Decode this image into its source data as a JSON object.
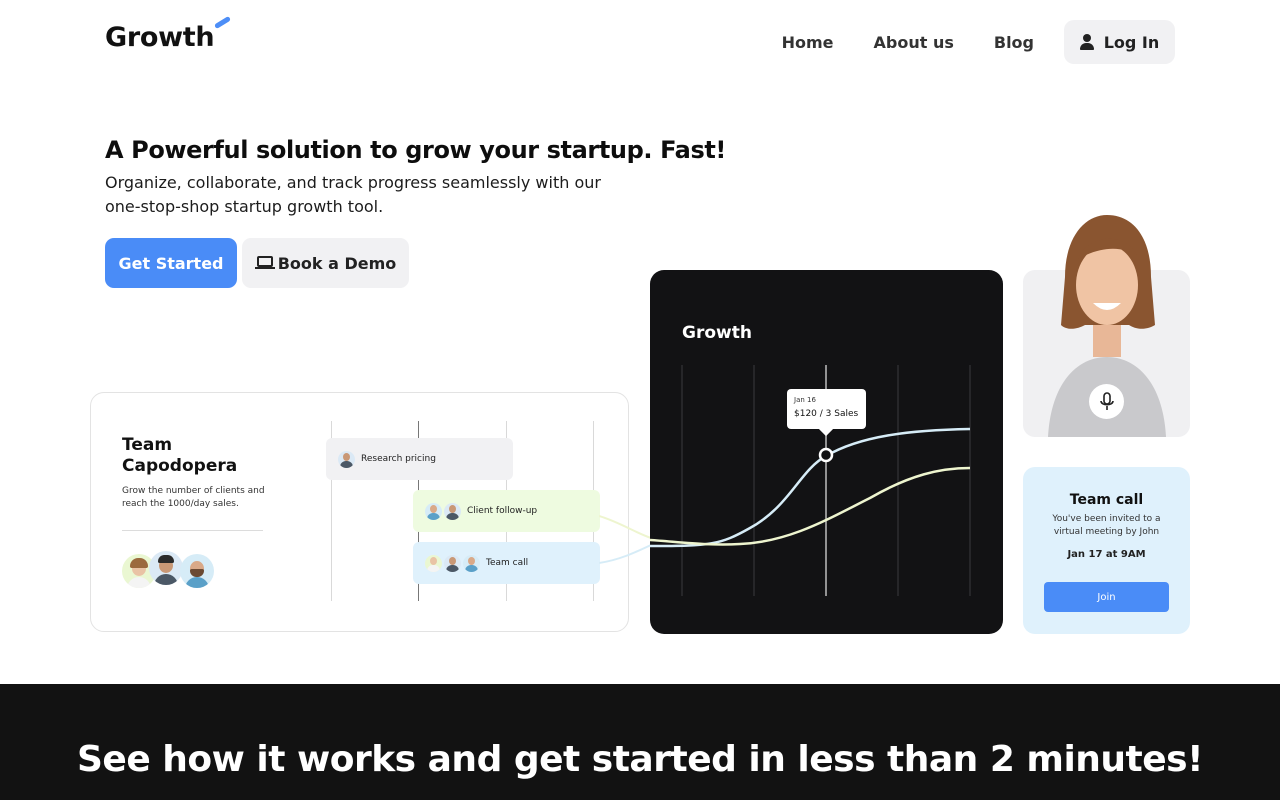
{
  "header": {
    "logo": "Growth",
    "nav": [
      "Home",
      "About us",
      "Blog"
    ],
    "login_label": "Log In"
  },
  "hero": {
    "title": "A Powerful solution to grow your startup. Fast!",
    "subtitle": "Organize, collaborate, and track progress seamlessly with our one-stop-shop startup growth tool.",
    "primary_button": "Get Started",
    "secondary_button": "Book a Demo"
  },
  "team_card": {
    "title": "Team Capodopera",
    "description": "Grow the number of clients and reach the 1000/day sales.",
    "tasks": [
      "Research pricing",
      "Client follow-up",
      "Team call"
    ]
  },
  "growth_card": {
    "title": "Growth",
    "tooltip_date": "Jan 16",
    "tooltip_value": "$120 / 3 Sales"
  },
  "call_card": {
    "title": "Team call",
    "description": "You've been invited to a virtual meeting by John",
    "time": "Jan 17 at 9AM",
    "join_label": "Join"
  },
  "bottom": {
    "title": "See how it works and get started in less than 2 minutes!"
  },
  "colors": {
    "accent": "#4a8cf7",
    "dark": "#121214",
    "call_bg": "#dff1fc",
    "task_green": "#eefbe0",
    "task_blue": "#dff1fc"
  }
}
